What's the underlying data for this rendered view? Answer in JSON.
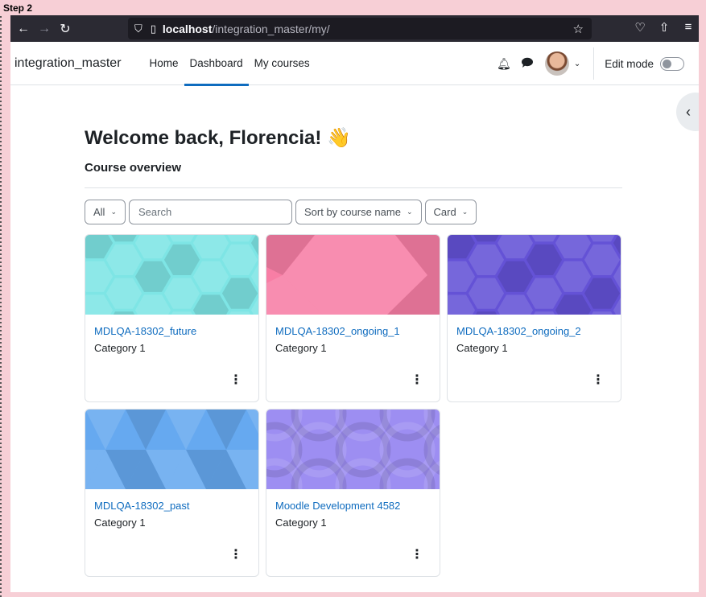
{
  "step_label": "Step 2",
  "browser": {
    "url_host": "localhost",
    "url_path": "/integration_master/my/"
  },
  "site": {
    "name": "integration_master",
    "nav": [
      {
        "label": "Home"
      },
      {
        "label": "Dashboard",
        "active": true
      },
      {
        "label": "My courses"
      }
    ],
    "edit_mode_label": "Edit mode"
  },
  "main": {
    "welcome": "Welcome back, Florencia! 👋",
    "section_title": "Course overview",
    "filters": {
      "grouping": "All",
      "search_placeholder": "Search",
      "sort": "Sort by course name",
      "view": "Card"
    },
    "courses": [
      {
        "name": "MDLQA-18302_future",
        "category": "Category 1",
        "color": "#7ee5e5",
        "pattern": "hex"
      },
      {
        "name": "MDLQA-18302_ongoing_1",
        "category": "Category 1",
        "color": "#f87ea5",
        "pattern": "poly"
      },
      {
        "name": "MDLQA-18302_ongoing_2",
        "category": "Category 1",
        "color": "#6452d6",
        "pattern": "hex"
      },
      {
        "name": "MDLQA-18302_past",
        "category": "Category 1",
        "color": "#66a9f0",
        "pattern": "tri"
      },
      {
        "name": "Moodle Development 4582",
        "category": "Category 1",
        "color": "#9d8ef2",
        "pattern": "circles"
      }
    ]
  }
}
